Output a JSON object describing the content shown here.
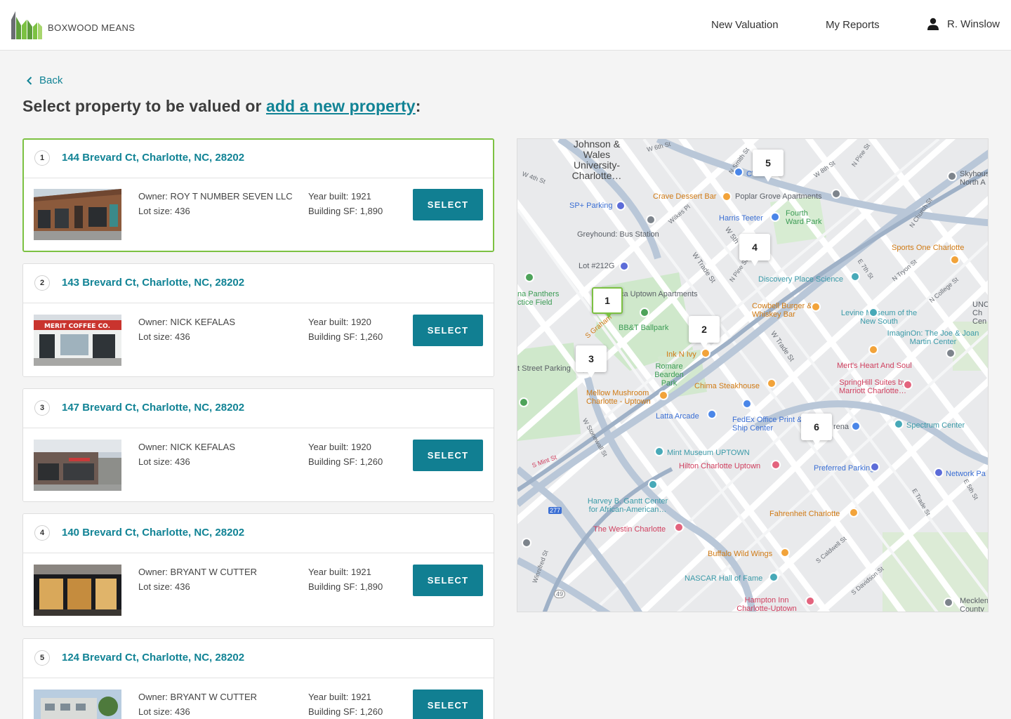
{
  "header": {
    "brand": "BOXWOOD MEANS",
    "nav": {
      "new_valuation": "New Valuation",
      "my_reports": "My Reports"
    },
    "user_name": "R. Winslow"
  },
  "back_label": "Back",
  "title": {
    "prefix": "Select property to be valued or ",
    "link": "add a new property",
    "suffix": ":"
  },
  "labels": {
    "owner": "Owner:",
    "lot": "Lot size:",
    "year": "Year built:",
    "sf": "Building SF:",
    "select": "SELECT"
  },
  "properties": [
    {
      "num": "1",
      "address": "144 Brevard Ct, Charlotte, NC, 28202",
      "owner": "ROY T NUMBER SEVEN LLC",
      "lot": "436",
      "year": "1921",
      "sf": "1,890",
      "selected": true
    },
    {
      "num": "2",
      "address": "143 Brevard Ct, Charlotte, NC, 28202",
      "owner": " NICK KEFALAS",
      "lot": "436",
      "year": "1920",
      "sf": "1,260",
      "selected": false,
      "sign_text": "MERIT COFFEE CO."
    },
    {
      "num": "3",
      "address": "147 Brevard Ct, Charlotte, NC, 28202",
      "owner": " NICK KEFALAS",
      "lot": "436",
      "year": "1920",
      "sf": "1,260",
      "selected": false
    },
    {
      "num": "4",
      "address": "140 Brevard Ct, Charlotte, NC, 28202",
      "owner": "BRYANT W CUTTER",
      "lot": "436",
      "year": "1921",
      "sf": "1,890",
      "selected": false
    },
    {
      "num": "5",
      "address": "124 Brevard Ct, Charlotte, NC, 28202",
      "owner": "BRYANT W CUTTER",
      "lot": "436",
      "year": "1921",
      "sf": "1,260",
      "selected": false
    }
  ],
  "map": {
    "markers": [
      "1",
      "2",
      "3",
      "4",
      "5",
      "6"
    ],
    "labels": {
      "jw": "Johnson & Wales University-Charlotte…",
      "crave": "Crave Dessert Bar",
      "poplar": "Poplar Grove Apartments",
      "sp": "SP+ Parking",
      "harris": "Harris Teeter",
      "fourth": "Fourth Ward Park",
      "greyhound": "Greyhound: Bus Station",
      "lot212": "Lot #212G",
      "panthers": "na Panthers ctice Field",
      "uptown": "ca Uptown Apartments",
      "bbt": "BB&T Ballpark",
      "inkn": "Ink N Ivy",
      "streetp": "t Street Parking",
      "romare": "Romare Bearden Park",
      "mellow": "Mellow Mushroom Charlotte - Uptown",
      "chima": "Chima Steakhouse",
      "latta": "Latta Arcade",
      "fedex": "FedEx Office Print & Ship Center",
      "arena": "rena",
      "spectrum": "Spectrum Center",
      "mint": "Mint Museum UPTOWN",
      "hilton": "Hilton Charlotte Uptown",
      "preferred": "Preferred Parking",
      "network": "Network Pa",
      "gantt": "Harvey B. Gantt Center for African-American…",
      "westin": "The Westin Charlotte",
      "fahrenheit": "Fahrenheit Charlotte",
      "buffalo": "Buffalo Wild Wings",
      "nascar": "NASCAR Hall of Fame",
      "hampton": "Hampton Inn Charlotte-Uptown",
      "meck": "Mecklen County",
      "discovery": "Discovery Place Science",
      "cowbell": "Cowbell Burger & Whiskey Bar",
      "levine": "Levine Museum of the New South",
      "imaginon": "ImaginOn: The Joe & Joan Martin Center",
      "merts": "Mert's Heart And Soul",
      "springhill": "SpringHill Suites by Marriott Charlotte…",
      "sportsone": "Sports One Charlotte",
      "unc": "UNC Ch Cen",
      "skyhouse": "Skyhous North A",
      "cvs": "CVS"
    },
    "streets": {
      "w6th": "W 6th St",
      "w4th": "W 4th St",
      "wsmith": "N Smith St",
      "w8th": "W 8th St",
      "npine": "N Pine St",
      "wtrade": "W Trade St",
      "wtrade2": "W Trade St",
      "wilkes": "Wilkes Pl",
      "wsth": "W 5th",
      "npine2": "N Pine St",
      "wtrade3": "W Trade St",
      "ntryon": "N Tryon St",
      "nchurch": "N Church St",
      "e7th": "E 7th St",
      "ncollege": "N College St",
      "sgraham": "S Graham",
      "wstonewall": "W Stonewall St",
      "smint": "S Mint St",
      "scaldwell": "S Caldwell St",
      "sdavidson": "S Davidson St",
      "etrade": "E Trade St",
      "e5th": "E 5th St",
      "winnifred": "Winnifred St",
      "i277": "277",
      "n49": "49"
    }
  }
}
